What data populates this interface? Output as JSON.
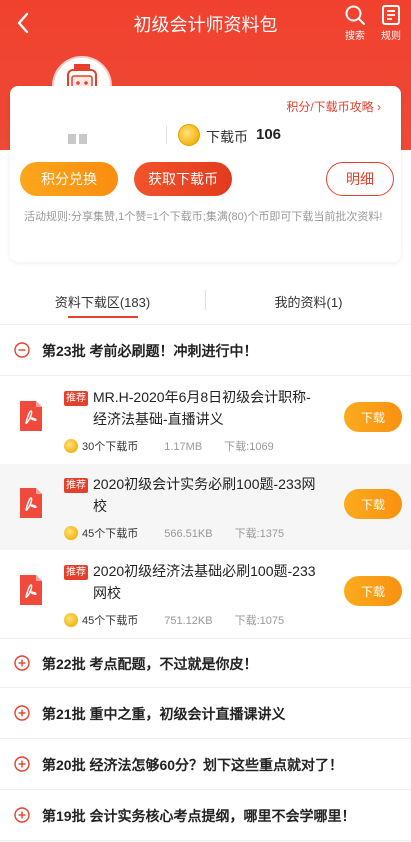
{
  "header": {
    "title": "初级会计师资料包",
    "search_label": "搜索",
    "rules_label": "规则"
  },
  "card": {
    "strategy_link": "积分/下载币攻略",
    "download_coin_label": "下载币",
    "download_coin_count": "106",
    "exchange_button": "积分兑换",
    "get_button": "获取下载币",
    "detail_button": "明细",
    "rules_text": "活动规则:分享集赞,1个赞=1个下载币;集满(80)个币即可下载当前批次资料!"
  },
  "tabs": [
    {
      "label": "资料下载区(183)",
      "active": true
    },
    {
      "label": "我的资料(1)",
      "active": false
    }
  ],
  "batches": {
    "b23": "第23批 考前必刷题！冲刺进行中！",
    "b22": "第22批 考点配题，不过就是你皮！",
    "b21": "第21批 重中之重，初级会计直播课讲义",
    "b20": "第20批 经济法怎够60分？划下这些重点就对了！",
    "b19": "第19批 会计实务核心考点提纲，哪里不会学哪里！"
  },
  "files": [
    {
      "tag": "推荐",
      "name": "MR.H-2020年6月8日初级会计职称-经济法基础-直播讲义",
      "cost": "30个下载币",
      "size": "1.17MB",
      "downloads": "下载:1069",
      "button": "下载"
    },
    {
      "tag": "推荐",
      "name": "2020初级会计实务必刷100题-233网校",
      "cost": "45个下载币",
      "size": "566.51KB",
      "downloads": "下载:1375",
      "button": "下载"
    },
    {
      "tag": "推荐",
      "name": "2020初级经济法基础必刷100题-233网校",
      "cost": "45个下载币",
      "size": "751.12KB",
      "downloads": "下载:1075",
      "button": "下载"
    }
  ],
  "colors": {
    "brand_red": "#ee4a36",
    "orange": "#fb9a14",
    "muted_text": "#999999"
  }
}
